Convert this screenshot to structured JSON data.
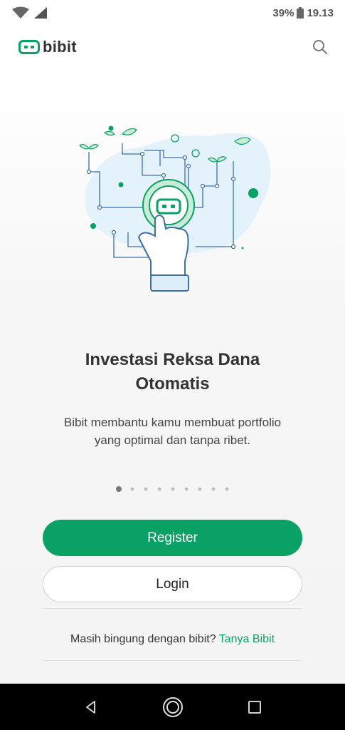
{
  "status_bar": {
    "battery": "39%",
    "time": "19.13"
  },
  "header": {
    "app_name": "bibit",
    "search_icon": "search-icon"
  },
  "slide": {
    "title_line1": "Investasi Reksa Dana",
    "title_line2": "Otomatis",
    "desc_line1": "Bibit membantu kamu membuat portfolio",
    "desc_line2": "yang optimal dan tanpa ribet."
  },
  "pager": {
    "count": 9,
    "active_index": 0
  },
  "actions": {
    "register_label": "Register",
    "login_label": "Login"
  },
  "help": {
    "text": "Masih bingung dengan bibit?",
    "link": "Tanya Bibit"
  },
  "colors": {
    "brand_green": "#0aa164",
    "light_blue": "#e4f3fb"
  }
}
